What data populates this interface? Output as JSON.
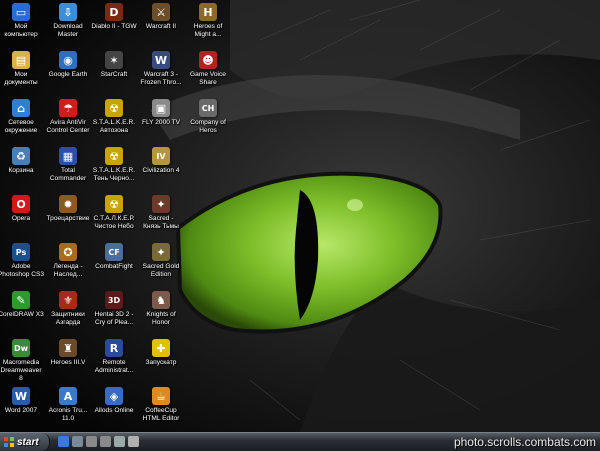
{
  "desktop": {
    "icons": [
      {
        "label": "Мой\nкомпьютер",
        "icon": "my-computer-icon",
        "glyph": "▭",
        "color": "#2a6bd6"
      },
      {
        "label": "Download\nMaster",
        "icon": "download-master-icon",
        "glyph": "⇩",
        "color": "#3b8fd8"
      },
      {
        "label": "Diablo II - TGW",
        "icon": "diablo-icon",
        "glyph": "D",
        "color": "#7a2a12"
      },
      {
        "label": "Warcraft II",
        "icon": "warcraft2-icon",
        "glyph": "⚔",
        "color": "#6b4f2a"
      },
      {
        "label": "Heroes of\nMight a...",
        "icon": "heroes-might-magic-icon",
        "glyph": "H",
        "color": "#8c6a2a"
      },
      {
        "label": "Мои\nдокументы",
        "icon": "my-documents-icon",
        "glyph": "▤",
        "color": "#d9b24a"
      },
      {
        "label": "Google Earth",
        "icon": "google-earth-icon",
        "glyph": "◉",
        "color": "#2f6fbf"
      },
      {
        "label": "StarCraft",
        "icon": "starcraft-icon",
        "glyph": "✶",
        "color": "#444"
      },
      {
        "label": "Warcraft 3 -\nFrozen Thro...",
        "icon": "warcraft3-icon",
        "glyph": "W",
        "color": "#3a4d7a"
      },
      {
        "label": "Game Voice\nShare",
        "icon": "game-voice-share-icon",
        "glyph": "☻",
        "color": "#b52020"
      },
      {
        "label": "Сетевое\nокружение",
        "icon": "network-icon",
        "glyph": "⌂",
        "color": "#2e7fd0"
      },
      {
        "label": "Avira AntiVir\nControl Center",
        "icon": "avira-icon",
        "glyph": "☂",
        "color": "#d01c1c"
      },
      {
        "label": "S.T.A.L.K.E.R.\nАвтозона",
        "icon": "stalker-radiation-icon",
        "glyph": "☢",
        "color": "#c8a400"
      },
      {
        "label": "FLY 2000 TV",
        "icon": "tv-icon",
        "glyph": "▣",
        "color": "#8a8a8a"
      },
      {
        "label": "Company of\nHeros",
        "icon": "company-of-heroes-icon",
        "glyph": "CH",
        "color": "#6a6a6a"
      },
      {
        "label": "Корзина",
        "icon": "recycle-bin-icon",
        "glyph": "♻",
        "color": "#4a7fb5"
      },
      {
        "label": "Total\nCommander",
        "icon": "total-commander-icon",
        "glyph": "▦",
        "color": "#2b4fa8"
      },
      {
        "label": "S.T.A.L.K.E.R.\nТень Черно...",
        "icon": "stalker-shadow-icon",
        "glyph": "☢",
        "color": "#c8a400"
      },
      {
        "label": "Civilization 4",
        "icon": "civilization-icon",
        "glyph": "IV",
        "color": "#b5963e"
      },
      {
        "label": "",
        "icon": "",
        "glyph": "",
        "color": ""
      },
      {
        "label": "Opera",
        "icon": "opera-icon",
        "glyph": "O",
        "color": "#d21818"
      },
      {
        "label": "Троецарствие",
        "icon": "three-kingdoms-icon",
        "glyph": "✹",
        "color": "#8a5a22"
      },
      {
        "label": "С.Т.А.Л.К.Е.Р.\nЧистое Небо",
        "icon": "stalker-clear-sky-icon",
        "glyph": "☢",
        "color": "#c8a400"
      },
      {
        "label": "Sacred -\nКнязь Тьмы",
        "icon": "sacred-icon",
        "glyph": "✦",
        "color": "#6b3a2a"
      },
      {
        "label": "",
        "icon": "",
        "glyph": "",
        "color": ""
      },
      {
        "label": "Adobe\nPhotoshop CS3",
        "icon": "photoshop-icon",
        "glyph": "Ps",
        "color": "#1e4f8a"
      },
      {
        "label": "Легенда -\nНаслед...",
        "icon": "legend-icon",
        "glyph": "✪",
        "color": "#a86a1e"
      },
      {
        "label": "CombatFight",
        "icon": "combatfight-icon",
        "glyph": "CF",
        "color": "#4a6e9a"
      },
      {
        "label": "Sacred Gold\nEdition",
        "icon": "sacred-gold-icon",
        "glyph": "✦",
        "color": "#7a6a3a"
      },
      {
        "label": "",
        "icon": "",
        "glyph": "",
        "color": ""
      },
      {
        "label": "CorelDRAW X3",
        "icon": "coreldraw-icon",
        "glyph": "✎",
        "color": "#2c9a2c"
      },
      {
        "label": "Защитники\nАзгарда",
        "icon": "asgard-defenders-icon",
        "glyph": "⚜",
        "color": "#a52a1a"
      },
      {
        "label": "Hentai 3D 2 -\nCry of Plea...",
        "icon": "hentai3d-icon",
        "glyph": "3D",
        "color": "#5a1a1a"
      },
      {
        "label": "Knights of\nHonor",
        "icon": "knights-of-honor-icon",
        "glyph": "♞",
        "color": "#7a5a4a"
      },
      {
        "label": "",
        "icon": "",
        "glyph": "",
        "color": ""
      },
      {
        "label": "Macromedia\nDreamweaver\n8",
        "icon": "dreamweaver-icon",
        "glyph": "Dw",
        "color": "#3a8a3a"
      },
      {
        "label": "Heroes III.V",
        "icon": "heroes3-icon",
        "glyph": "♜",
        "color": "#6a4a2a"
      },
      {
        "label": "Remote\nAdministrat...",
        "icon": "remote-admin-icon",
        "glyph": "R",
        "color": "#2a4a9a"
      },
      {
        "label": "Запускатр",
        "icon": "launcher-icon",
        "glyph": "✚",
        "color": "#e0c000"
      },
      {
        "label": "",
        "icon": "",
        "glyph": "",
        "color": ""
      },
      {
        "label": "Word 2007",
        "icon": "word-icon",
        "glyph": "W",
        "color": "#2a5aa8"
      },
      {
        "label": "Acronis Tru...\n11.0",
        "icon": "acronis-icon",
        "glyph": "A",
        "color": "#3a7ac8"
      },
      {
        "label": "Allods Online",
        "icon": "allods-icon",
        "glyph": "◈",
        "color": "#3a6ac8"
      },
      {
        "label": "CoffeeCup\nHTML Editor",
        "icon": "coffeecup-icon",
        "glyph": "☕",
        "color": "#e08a1e"
      },
      {
        "label": "",
        "icon": "",
        "glyph": "",
        "color": ""
      }
    ]
  },
  "taskbar": {
    "start_label": "start",
    "watermark": "photo.scrolls.combats.com",
    "quick_launch": [
      {
        "icon": "ie-icon",
        "color": "#3a7ad8"
      },
      {
        "icon": "desktop-show-icon",
        "color": "#7a8a9a"
      },
      {
        "icon": "drive-icon",
        "color": "#8a8a8a"
      },
      {
        "icon": "drive-icon",
        "color": "#8a8a8a"
      },
      {
        "icon": "network-icon",
        "color": "#9aa"
      },
      {
        "icon": "folder-icon",
        "color": "#b0b0b0"
      }
    ]
  }
}
